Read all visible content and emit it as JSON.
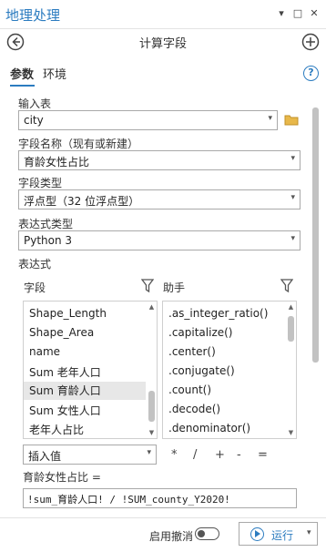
{
  "window": {
    "title": "地理处理"
  },
  "header": {
    "title": "计算字段"
  },
  "tabs": [
    {
      "label": "参数"
    },
    {
      "label": "环境"
    }
  ],
  "help_icon_text": "?",
  "params": {
    "input_table": {
      "label": "输入表",
      "value": "city"
    },
    "field_name": {
      "label": "字段名称（现有或新建）",
      "value": "育龄女性占比"
    },
    "field_type": {
      "label": "字段类型",
      "value": "浮点型（32 位浮点型）"
    },
    "expression_type": {
      "label": "表达式类型",
      "value": "Python 3"
    },
    "expression": {
      "label": "表达式"
    }
  },
  "fields": {
    "header": "字段",
    "items": [
      "Shape_Length",
      "Shape_Area",
      "name",
      "Sum 老年人口",
      "Sum 育龄人口",
      "Sum 女性人口",
      "老年人占比"
    ],
    "selected_index": 4
  },
  "helpers": {
    "header": "助手",
    "items": [
      ".as_integer_ratio()",
      ".capitalize()",
      ".center()",
      ".conjugate()",
      ".count()",
      ".decode()",
      ".denominator()"
    ]
  },
  "insert_value": {
    "label": "插入值"
  },
  "operators": [
    "*",
    "/",
    "+",
    "-",
    "="
  ],
  "expression_label": "育龄女性占比 =",
  "expression_value": "!sum_育龄人口! / !SUM_county_Y2020!",
  "bottom": {
    "enable_undo_label": "启用撤消",
    "run_label": "运行"
  }
}
